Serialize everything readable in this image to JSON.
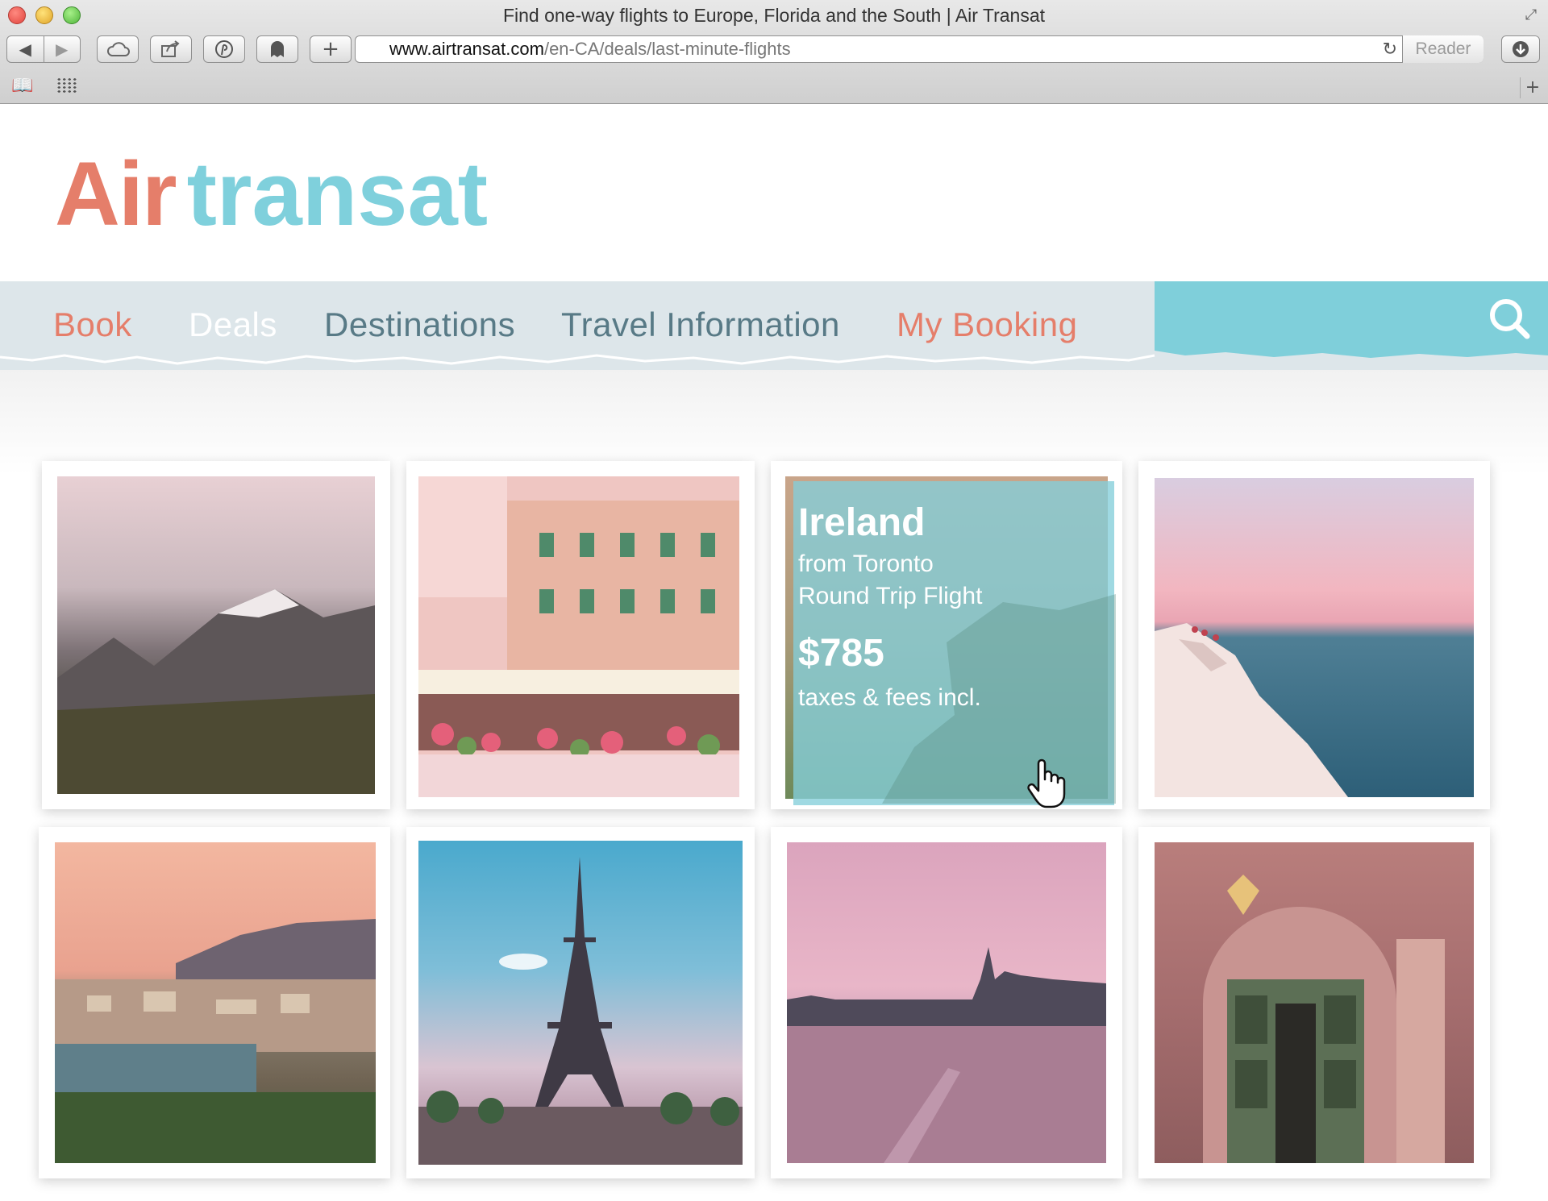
{
  "window": {
    "title": "Find one-way flights to Europe, Florida and the South | Air Transat"
  },
  "toolbar": {
    "url_host": "www.airtransat.com",
    "url_path": "/en-CA/deals/last-minute-flights",
    "reader_label": "Reader"
  },
  "logo": {
    "part1": "Air",
    "part2": "transat"
  },
  "nav": {
    "items": [
      {
        "label": "Book",
        "color": "#e57e6a"
      },
      {
        "label": "Deals",
        "color": "#ffffff"
      },
      {
        "label": "Destinations",
        "color": "#587a86"
      },
      {
        "label": "Travel Information",
        "color": "#587a86"
      },
      {
        "label": "My Booking",
        "color": "#e57e6a"
      }
    ]
  },
  "colors": {
    "brand_coral": "#e57e6a",
    "brand_teal": "#7fcfda",
    "nav_band": "#dde6ea"
  },
  "deal": {
    "destination": "Ireland",
    "from": "from Toronto",
    "trip_type": "Round Trip Flight",
    "price": "$785",
    "taxes": "taxes & fees incl."
  }
}
